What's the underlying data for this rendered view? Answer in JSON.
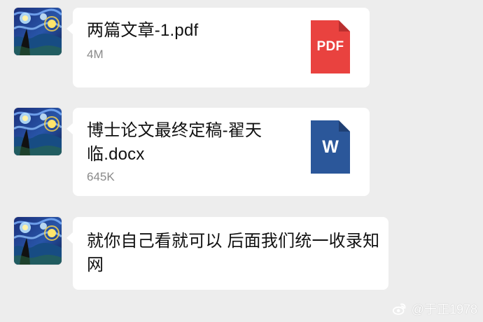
{
  "messages": [
    {
      "type": "file",
      "title": "两篇文章-1.pdf",
      "size": "4M",
      "icon": "pdf-file-icon",
      "icon_label": "PDF",
      "icon_color": "#e9423f"
    },
    {
      "type": "file",
      "title": "博士论文最终定稿-翟天临.docx",
      "size": "645K",
      "icon": "word-file-icon",
      "icon_label": "W",
      "icon_color": "#2b579a"
    },
    {
      "type": "text",
      "text": "就你自己看就可以 后面我们统一收录知网"
    }
  ],
  "watermark": {
    "text": "@于正1978",
    "icon": "weibo-icon"
  }
}
